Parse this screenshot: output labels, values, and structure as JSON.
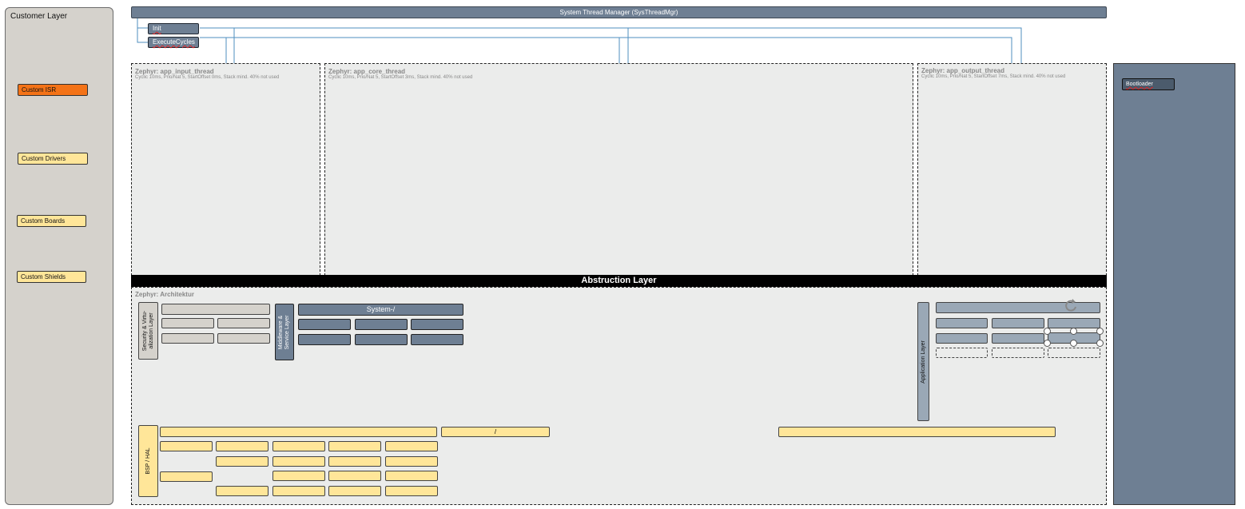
{
  "customer_layer": {
    "title": "Customer Layer",
    "items": [
      "Custom ISR",
      "Custom Drivers",
      "Custom Boards",
      "Custom Shields"
    ]
  },
  "thread_manager": {
    "title": "System Thread Manager (SysThreadMgr)",
    "init_label": "Init",
    "execute_label": "ExecuteCycles"
  },
  "threads": [
    {
      "title": "Zephyr: app_input_thread",
      "subtitle": "Cyclic 10ms, Prio/Nat 5, StartOffset 0ms, Stack mind. 40% not used"
    },
    {
      "title": "Zephyr: app_core_thread",
      "subtitle": "Cyclic 10ms, Prio/Nat 5, StartOffset 3ms, Stack mind. 40% not used"
    },
    {
      "title": "Zephyr: app_output_thread",
      "subtitle": "Cyclic 10ms, Prio/Nat 5, StartOffset 7ms, Stack mind. 40% not used"
    }
  ],
  "abstraction": {
    "title": "Abstruction Layer"
  },
  "architecture": {
    "title": "Zephyr: Architektur",
    "security_label": "Security & Virtu-\nalization Layer",
    "middleware_label": "Middleware &\nService Layer",
    "system_label": "System-/",
    "application_label": "Application Layer",
    "bsp_label": "BSP / HAL",
    "bsp_mid_label": "/"
  },
  "bootloader": {
    "label": "Bootloader"
  },
  "colors": {
    "slate": "#6e7f93",
    "orange": "#f47317",
    "yellow": "#ffe699",
    "gray": "#d5d2cc",
    "connector": "#4f8fbf"
  }
}
